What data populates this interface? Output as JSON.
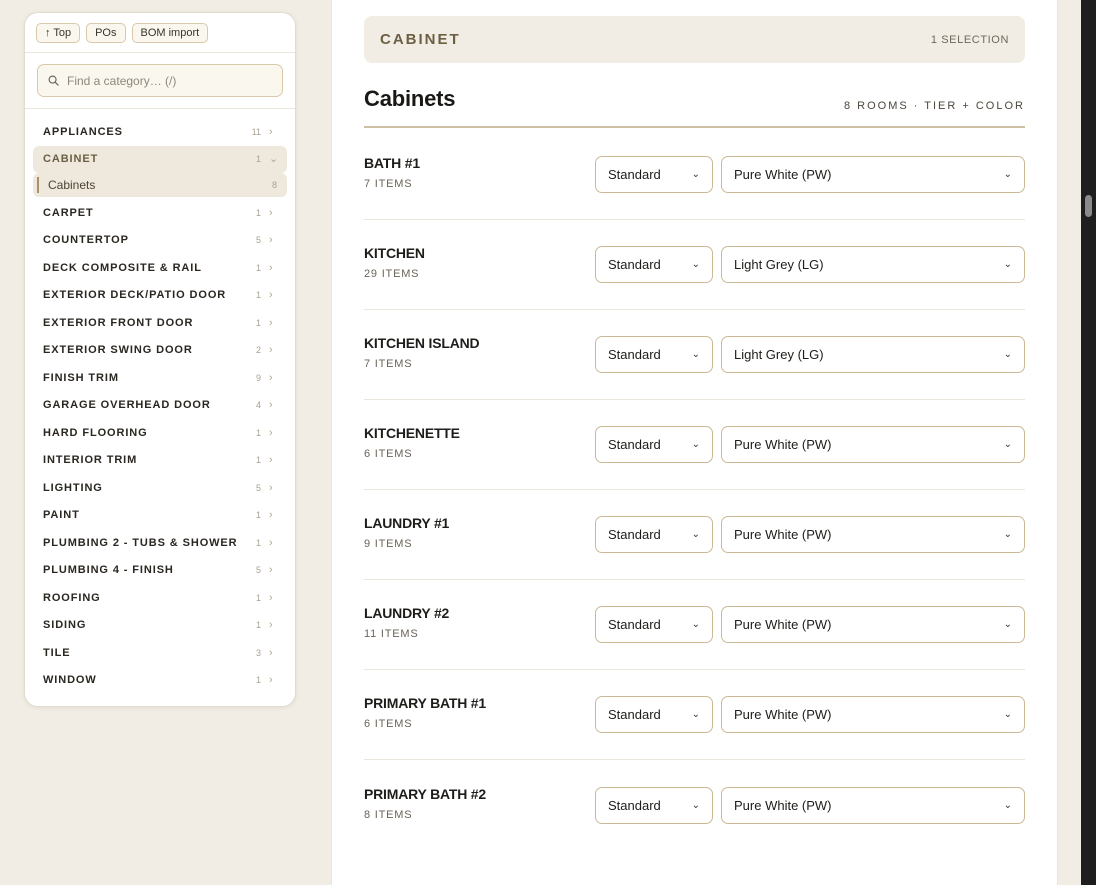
{
  "sidebar": {
    "top_buttons": [
      {
        "label": "↑ Top"
      },
      {
        "label": "POs"
      },
      {
        "label": "BOM import"
      }
    ],
    "search": {
      "placeholder": "Find a category… (/)"
    },
    "categories": [
      {
        "label": "APPLIANCES",
        "count": "11",
        "chevron": "›"
      },
      {
        "label": "CABINET",
        "count": "1",
        "chevron": "⌄",
        "active": true
      },
      {
        "label": "CARPET",
        "count": "1",
        "chevron": "›"
      },
      {
        "label": "COUNTERTOP",
        "count": "5",
        "chevron": "›"
      },
      {
        "label": "DECK COMPOSITE & RAIL",
        "count": "1",
        "chevron": "›"
      },
      {
        "label": "EXTERIOR DECK/PATIO DOOR",
        "count": "1",
        "chevron": "›"
      },
      {
        "label": "EXTERIOR FRONT DOOR",
        "count": "1",
        "chevron": "›"
      },
      {
        "label": "EXTERIOR SWING DOOR",
        "count": "2",
        "chevron": "›"
      },
      {
        "label": "FINISH TRIM",
        "count": "9",
        "chevron": "›"
      },
      {
        "label": "GARAGE OVERHEAD DOOR",
        "count": "4",
        "chevron": "›"
      },
      {
        "label": "HARD FLOORING",
        "count": "1",
        "chevron": "›"
      },
      {
        "label": "INTERIOR TRIM",
        "count": "1",
        "chevron": "›"
      },
      {
        "label": "LIGHTING",
        "count": "5",
        "chevron": "›"
      },
      {
        "label": "PAINT",
        "count": "1",
        "chevron": "›"
      },
      {
        "label": "PLUMBING 2 - TUBS & SHOWER",
        "count": "1",
        "chevron": "›"
      },
      {
        "label": "PLUMBING 4 - FINISH",
        "count": "5",
        "chevron": "›"
      },
      {
        "label": "ROOFING",
        "count": "1",
        "chevron": "›"
      },
      {
        "label": "SIDING",
        "count": "1",
        "chevron": "›"
      },
      {
        "label": "TILE",
        "count": "3",
        "chevron": "›"
      },
      {
        "label": "WINDOW",
        "count": "1",
        "chevron": "›"
      }
    ],
    "subcategory": {
      "label": "Cabinets",
      "count": "8"
    }
  },
  "main": {
    "banner": {
      "title": "CABINET",
      "selection": "1 SELECTION"
    },
    "section": {
      "title": "Cabinets",
      "meta": "8 ROOMS · TIER + COLOR"
    },
    "rooms": [
      {
        "name": "BATH #1",
        "items": "7 ITEMS",
        "tier": "Standard",
        "color": "Pure White (PW)"
      },
      {
        "name": "KITCHEN",
        "items": "29 ITEMS",
        "tier": "Standard",
        "color": "Light Grey (LG)"
      },
      {
        "name": "KITCHEN ISLAND",
        "items": "7 ITEMS",
        "tier": "Standard",
        "color": "Light Grey (LG)"
      },
      {
        "name": "KITCHENETTE",
        "items": "6 ITEMS",
        "tier": "Standard",
        "color": "Pure White (PW)"
      },
      {
        "name": "LAUNDRY #1",
        "items": "9 ITEMS",
        "tier": "Standard",
        "color": "Pure White (PW)"
      },
      {
        "name": "LAUNDRY #2",
        "items": "11 ITEMS",
        "tier": "Standard",
        "color": "Pure White (PW)"
      },
      {
        "name": "PRIMARY BATH #1",
        "items": "6 ITEMS",
        "tier": "Standard",
        "color": "Pure White (PW)"
      },
      {
        "name": "PRIMARY BATH #2",
        "items": "8 ITEMS",
        "tier": "Standard",
        "color": "Pure White (PW)"
      }
    ]
  },
  "colors": {
    "page_bg": "#f1ede4",
    "accent": "#a8926a",
    "border": "#cbb995"
  }
}
